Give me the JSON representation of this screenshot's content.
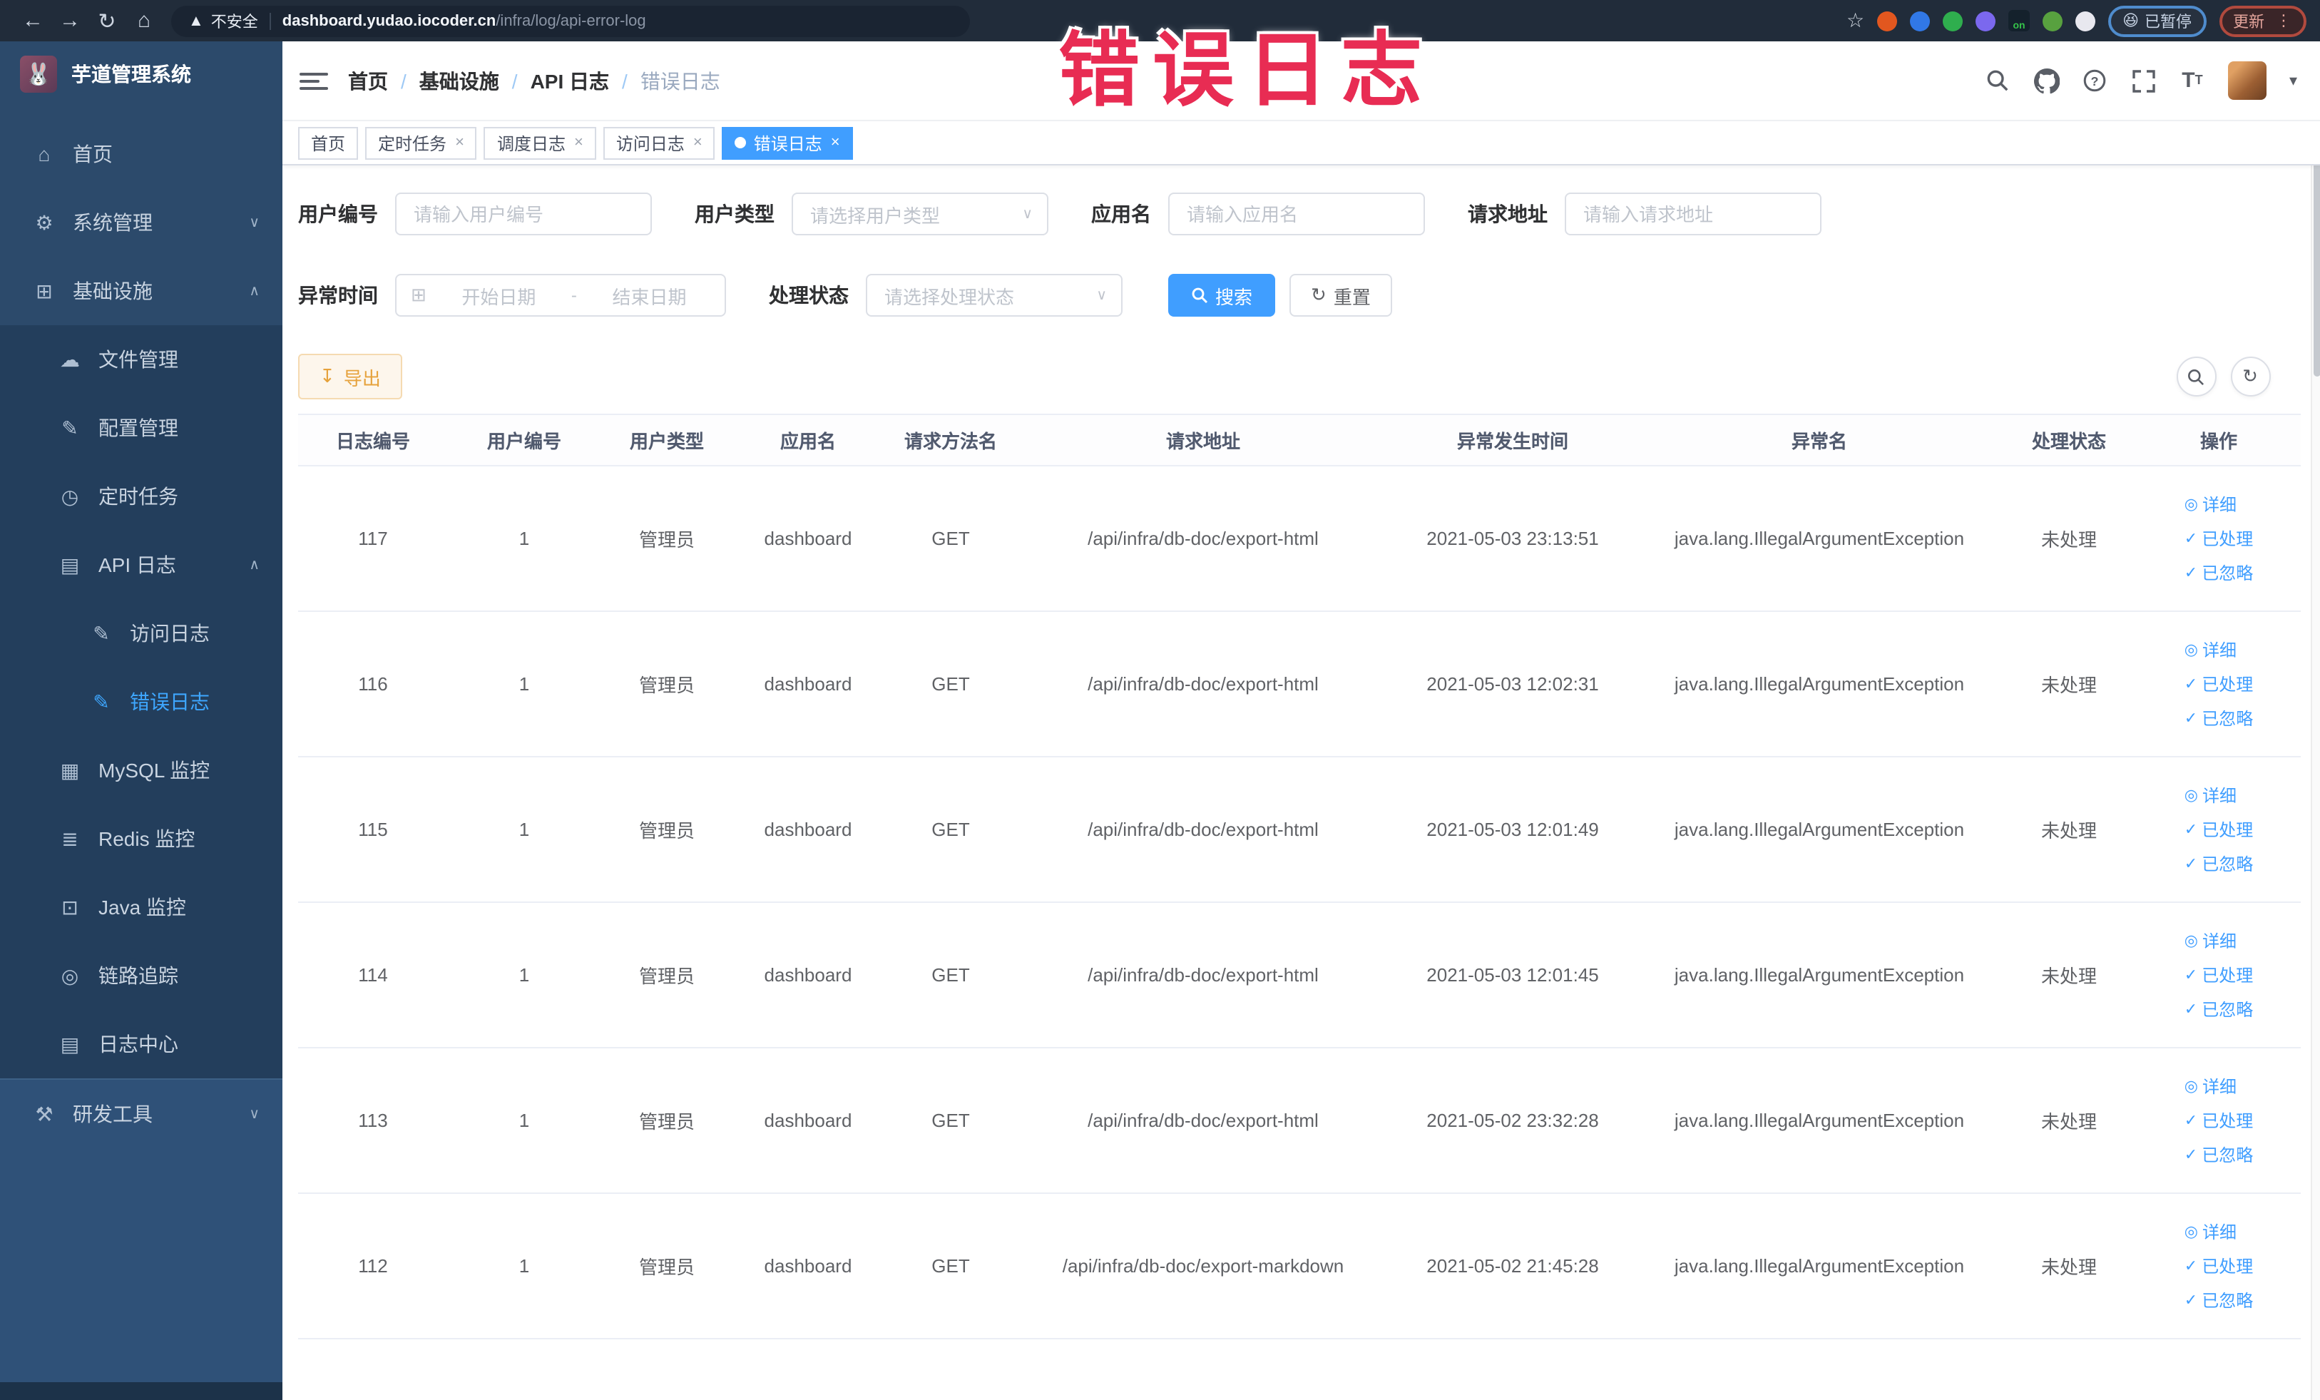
{
  "browser": {
    "security_label": "不安全",
    "url_host": "dashboard.yudao.iocoder.cn",
    "url_path": "/infra/log/api-error-log",
    "paused_badge_emoji": "😆",
    "paused_badge": "已暂停",
    "update_button": "更新",
    "extensions": [
      {
        "name": "extension-orange",
        "color": "#e2571f"
      },
      {
        "name": "extension-blue-shield",
        "color": "#3178e6"
      },
      {
        "name": "extension-green-circle",
        "color": "#2fae4e"
      },
      {
        "name": "extension-grid",
        "color": "#7b68ee"
      },
      {
        "name": "extension-on-badge",
        "color": "#14212c",
        "label": "on"
      },
      {
        "name": "extension-leaf",
        "color": "#58a13f"
      },
      {
        "name": "extension-white-star",
        "color": "#e8e8ef"
      }
    ]
  },
  "overlay": {
    "text": "错误日志",
    "color": "#e82c53"
  },
  "sidebar": {
    "title": "芋道管理系统",
    "items": [
      {
        "name": "home",
        "label": "首页",
        "icon": "home",
        "level": 0,
        "section": "top"
      },
      {
        "name": "system-management",
        "label": "系统管理",
        "icon": "gear",
        "level": 0,
        "section": "top",
        "chevron": "down"
      },
      {
        "name": "infrastructure",
        "label": "基础设施",
        "icon": "infra",
        "level": 0,
        "section": "top",
        "chevron": "up"
      },
      {
        "name": "file-management",
        "label": "文件管理",
        "icon": "cloud",
        "level": 1,
        "section": "sub"
      },
      {
        "name": "config-management",
        "label": "配置管理",
        "icon": "edit",
        "level": 1,
        "section": "sub"
      },
      {
        "name": "scheduled-tasks",
        "label": "定时任务",
        "icon": "clock",
        "level": 1,
        "section": "sub"
      },
      {
        "name": "api-log",
        "label": "API 日志",
        "icon": "log",
        "level": 1,
        "section": "sub",
        "chevron": "up"
      },
      {
        "name": "access-log",
        "label": "访问日志",
        "icon": "edit",
        "level": 2,
        "section": "sub"
      },
      {
        "name": "error-log",
        "label": "错误日志",
        "icon": "edit",
        "level": 2,
        "section": "sub",
        "active": true
      },
      {
        "name": "mysql-monitor",
        "label": "MySQL 监控",
        "icon": "mysql",
        "level": 1,
        "section": "sub"
      },
      {
        "name": "redis-monitor",
        "label": "Redis 监控",
        "icon": "redis",
        "level": 1,
        "section": "sub"
      },
      {
        "name": "java-monitor",
        "label": "Java 监控",
        "icon": "java",
        "level": 1,
        "section": "sub"
      },
      {
        "name": "trace",
        "label": "链路追踪",
        "icon": "eye",
        "level": 1,
        "section": "sub"
      },
      {
        "name": "log-center",
        "label": "日志中心",
        "icon": "log",
        "level": 1,
        "section": "sub"
      },
      {
        "name": "dev-tools",
        "label": "研发工具",
        "icon": "tools",
        "level": 0,
        "section": "bottom",
        "chevron": "down"
      }
    ]
  },
  "header": {
    "breadcrumb": [
      "首页",
      "基础设施",
      "API 日志",
      "错误日志"
    ]
  },
  "tabs": [
    {
      "label": "首页",
      "closable": false,
      "active": false
    },
    {
      "label": "定时任务",
      "closable": true,
      "active": false
    },
    {
      "label": "调度日志",
      "closable": true,
      "active": false
    },
    {
      "label": "访问日志",
      "closable": true,
      "active": false
    },
    {
      "label": "错误日志",
      "closable": true,
      "active": true
    }
  ],
  "filters": {
    "user_id_label": "用户编号",
    "user_id_placeholder": "请输入用户编号",
    "user_type_label": "用户类型",
    "user_type_placeholder": "请选择用户类型",
    "app_name_label": "应用名",
    "app_name_placeholder": "请输入应用名",
    "request_url_label": "请求地址",
    "request_url_placeholder": "请输入请求地址",
    "exception_time_label": "异常时间",
    "start_date_placeholder": "开始日期",
    "range_separator": "-",
    "end_date_placeholder": "结束日期",
    "process_status_label": "处理状态",
    "process_status_placeholder": "请选择处理状态",
    "search_button": "搜索",
    "reset_button": "重置"
  },
  "toolbar": {
    "export_button": "导出"
  },
  "table": {
    "columns": [
      "日志编号",
      "用户编号",
      "用户类型",
      "应用名",
      "请求方法名",
      "请求地址",
      "异常发生时间",
      "异常名",
      "处理状态",
      "操作"
    ],
    "rows": [
      {
        "log_id": "117",
        "user_id": "1",
        "user_type": "管理员",
        "app_name": "dashboard",
        "method": "GET",
        "url": "/api/infra/db-doc/export-html",
        "time": "2021-05-03 23:13:51",
        "exception": "java.lang.IllegalArgumentException",
        "status": "未处理"
      },
      {
        "log_id": "116",
        "user_id": "1",
        "user_type": "管理员",
        "app_name": "dashboard",
        "method": "GET",
        "url": "/api/infra/db-doc/export-html",
        "time": "2021-05-03 12:02:31",
        "exception": "java.lang.IllegalArgumentException",
        "status": "未处理"
      },
      {
        "log_id": "115",
        "user_id": "1",
        "user_type": "管理员",
        "app_name": "dashboard",
        "method": "GET",
        "url": "/api/infra/db-doc/export-html",
        "time": "2021-05-03 12:01:49",
        "exception": "java.lang.IllegalArgumentException",
        "status": "未处理"
      },
      {
        "log_id": "114",
        "user_id": "1",
        "user_type": "管理员",
        "app_name": "dashboard",
        "method": "GET",
        "url": "/api/infra/db-doc/export-html",
        "time": "2021-05-03 12:01:45",
        "exception": "java.lang.IllegalArgumentException",
        "status": "未处理"
      },
      {
        "log_id": "113",
        "user_id": "1",
        "user_type": "管理员",
        "app_name": "dashboard",
        "method": "GET",
        "url": "/api/infra/db-doc/export-html",
        "time": "2021-05-02 23:32:28",
        "exception": "java.lang.IllegalArgumentException",
        "status": "未处理"
      },
      {
        "log_id": "112",
        "user_id": "1",
        "user_type": "管理员",
        "app_name": "dashboard",
        "method": "GET",
        "url": "/api/infra/db-doc/export-markdown",
        "time": "2021-05-02 21:45:28",
        "exception": "java.lang.IllegalArgumentException",
        "status": "未处理"
      }
    ],
    "row_actions": [
      "详细",
      "已处理",
      "已忽略"
    ]
  }
}
